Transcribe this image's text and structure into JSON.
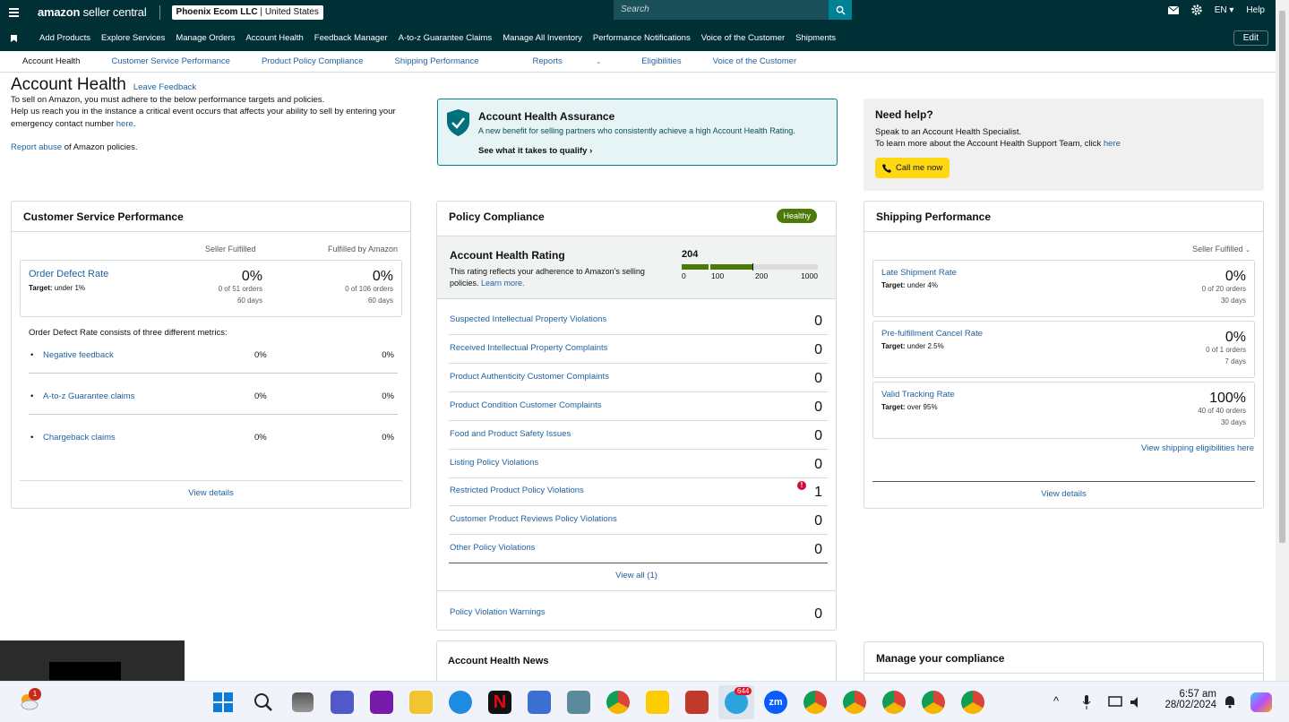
{
  "topbar": {
    "logo_a": "amazon",
    "logo_b": "seller central",
    "account_name": "Phoenix Ecom LLC",
    "account_region": "United States",
    "search_placeholder": "Search",
    "language": "EN",
    "help": "Help"
  },
  "nav": {
    "items": [
      "Add Products",
      "Explore Services",
      "Manage Orders",
      "Account Health",
      "Feedback Manager",
      "A-to-z Guarantee Claims",
      "Manage All Inventory",
      "Performance Notifications",
      "Voice of the Customer",
      "Shipments"
    ],
    "edit": "Edit"
  },
  "subnav": {
    "items": [
      "Account Health",
      "Customer Service Performance",
      "Product Policy Compliance",
      "Shipping Performance",
      "Reports",
      "Eligibilities",
      "Voice of the Customer"
    ]
  },
  "intro": {
    "title": "Account Health",
    "leave_feedback": "Leave Feedback",
    "line1": "To sell on Amazon, you must adhere to the below performance targets and policies.",
    "line2": "Help us reach you in the instance a critical event occurs that affects your ability to sell by entering your",
    "line3": "emergency contact number",
    "here": "here",
    "report_abuse": "Report abuse",
    "report_tail": "of Amazon policies."
  },
  "aha": {
    "title": "Account Health Assurance",
    "text": "A new benefit for selling partners who consistently achieve a high Account Health Rating.",
    "link": "See what it takes to qualify"
  },
  "help": {
    "title": "Need help?",
    "line1": "Speak to an Account Health Specialist.",
    "line2": "To learn more about the Account Health Support Team, click",
    "here": "here",
    "button": "Call me now"
  },
  "csp": {
    "title": "Customer Service Performance",
    "col1": "Seller Fulfilled",
    "col2": "Fulfilled by Amazon",
    "odr": "Order Defect Rate",
    "target": "Target:",
    "target_value": "under 1%",
    "v1": "0%",
    "v1s": "0 of 51 orders",
    "v1d": "60 days",
    "v2": "0%",
    "v2s": "0 of 106 orders",
    "v2d": "60 days",
    "consists": "Order Defect Rate consists of three different metrics:",
    "metrics": [
      {
        "label": "Negative feedback",
        "a": "0%",
        "b": "0%"
      },
      {
        "label": "A-to-z Guarantee claims",
        "a": "0%",
        "b": "0%"
      },
      {
        "label": "Chargeback claims",
        "a": "0%",
        "b": "0%"
      }
    ],
    "view": "View details"
  },
  "pc": {
    "title": "Policy Compliance",
    "badge": "Healthy",
    "ahr": "Account Health Rating",
    "ahr_text": "This rating reflects your adherence to Amazon's selling policies.",
    "learn": "Learn more.",
    "score": "204",
    "score_value": 204,
    "scale": [
      "0",
      "100",
      "200",
      "1000"
    ],
    "rows": [
      {
        "label": "Suspected Intellectual Property Violations",
        "v": "0"
      },
      {
        "label": "Received Intellectual Property Complaints",
        "v": "0"
      },
      {
        "label": "Product Authenticity Customer Complaints",
        "v": "0"
      },
      {
        "label": "Product Condition Customer Complaints",
        "v": "0"
      },
      {
        "label": "Food and Product Safety Issues",
        "v": "0"
      },
      {
        "label": "Listing Policy Violations",
        "v": "0"
      },
      {
        "label": "Restricted Product Policy Violations",
        "v": "1"
      },
      {
        "label": "Customer Product Reviews Policy Violations",
        "v": "0"
      },
      {
        "label": "Other Policy Violations",
        "v": "0"
      }
    ],
    "view_all": "View all (1)",
    "warnings": "Policy Violation Warnings",
    "warnings_v": "0"
  },
  "news": {
    "title": "Account Health News"
  },
  "sp": {
    "title": "Shipping Performance",
    "filter": "Seller Fulfilled",
    "metrics": [
      {
        "label": "Late Shipment Rate",
        "target": "under 4%",
        "v": "0%",
        "s": "0 of 20 orders",
        "d": "30 days"
      },
      {
        "label": "Pre-fulfillment Cancel Rate",
        "target": "under 2.5%",
        "v": "0%",
        "s": "0 of 1 orders",
        "d": "7 days"
      },
      {
        "label": "Valid Tracking Rate",
        "target": "over 95%",
        "v": "100%",
        "s": "40 of 40 orders",
        "d": "30 days"
      }
    ],
    "elig": "View shipping eligibilities here",
    "view": "View details"
  },
  "manage": {
    "title": "Manage your compliance"
  },
  "taskbar": {
    "time": "6:57 am",
    "date": "28/02/2024",
    "badge_weather": "1",
    "badge_telegram": "644"
  }
}
